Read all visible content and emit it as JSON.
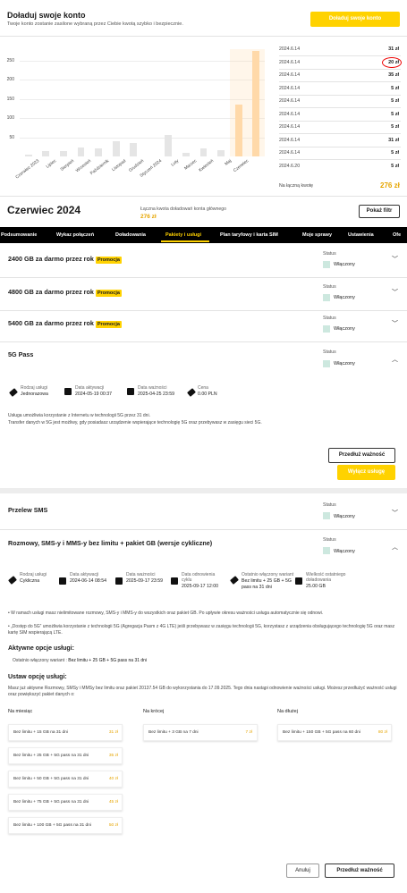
{
  "top": {
    "title": "Doładuj swoje konto",
    "subtitle": "Twoje konto zostanie zasilone wybraną przez Ciebie kwotą szybko i bezpiecznie.",
    "button": "Doładuj swoje konto"
  },
  "chart_data": {
    "type": "bar",
    "categories": [
      "Czerwiec 2023",
      "Lipiec",
      "Sierpień",
      "Wrzesień",
      "Październik",
      "Listopad",
      "Grudzień",
      "Styczeń 2024",
      "Luty",
      "Marzec",
      "Kwiecień",
      "Maj",
      "Czerwiec"
    ],
    "values": [
      5,
      13,
      15,
      24,
      20,
      40,
      35,
      0,
      55,
      10,
      20,
      17,
      135,
      276
    ],
    "yticks": [
      "250",
      "200",
      "150",
      "100",
      "50"
    ],
    "ylim": [
      0,
      280
    ],
    "highlight": "Czerwiec"
  },
  "history": [
    {
      "date": "2024.6.14",
      "amount": "31 zł"
    },
    {
      "date": "2024.6.14",
      "amount": "20 zł"
    },
    {
      "date": "2024.6.14",
      "amount": "35 zł"
    },
    {
      "date": "2024.6.14",
      "amount": "5 zł"
    },
    {
      "date": "2024.6.14",
      "amount": "5 zł"
    },
    {
      "date": "2024.6.14",
      "amount": "5 zł"
    },
    {
      "date": "2024.6.14",
      "amount": "5 zł"
    },
    {
      "date": "2024.6.14",
      "amount": "31 zł"
    },
    {
      "date": "2024.6.14",
      "amount": "5 zł"
    },
    {
      "date": "2024.6.20",
      "amount": "5 zł"
    }
  ],
  "history_sum": {
    "label": "Na łączną kwotę",
    "value": "276 zł"
  },
  "month": {
    "title": "Czerwiec 2024",
    "sub": "Łączna kwota doładowań konta głównego",
    "value": "276 zł",
    "filter_button": "Pokaż filtr"
  },
  "nav": [
    {
      "label": "Podsumowanie"
    },
    {
      "label": "Wykaz połączeń"
    },
    {
      "label": "Doładowania"
    },
    {
      "label": "Pakiety i usługi"
    },
    {
      "label": "Plan taryfowy i karta SIM"
    },
    {
      "label": "Moje sprawy"
    },
    {
      "label": "Ustawienia"
    },
    {
      "label": "Ofe"
    }
  ],
  "promo_label": "Promocja",
  "status_label": "Status",
  "status_value": "Włączony",
  "packages": [
    {
      "title": "2400 GB za darmo przez rok"
    },
    {
      "title": "4800 GB za darmo przez rok"
    },
    {
      "title": "5400 GB za darmo przez rok"
    }
  ],
  "pass5g": {
    "title": "5G Pass",
    "details": [
      {
        "label": "Rodzaj usługi",
        "value": "Jednorazowa"
      },
      {
        "label": "Data aktywacji",
        "value": "2024-05-19 00:37"
      },
      {
        "label": "Data ważności",
        "value": "2025-04-25 23:59"
      },
      {
        "label": "Cena",
        "value": "0.00 PLN"
      }
    ],
    "desc1": "Usługa umożliwia korzystanie z Internetu w technologii 5G przez 31 dni.",
    "desc2": "Transfer danych w 5G jest możliwy, gdy posiadasz urządzenie wspierające technologię 5G oraz przebywasz w zasięgu sieci 5G.",
    "extend": "Przedłuż ważność",
    "disable": "Wyłącz usługę"
  },
  "sms": {
    "title": "Przelew SMS"
  },
  "unlimited": {
    "title": "Rozmowy, SMS-y i MMS-y bez limitu + pakiet GB (wersje cykliczne)",
    "details": [
      {
        "label": "Rodzaj usługi",
        "value": "Cykliczna"
      },
      {
        "label": "Data aktywacji",
        "value": "2024-06-14 08:54"
      },
      {
        "label": "Data ważności",
        "value": "2025-09-17 23:59"
      },
      {
        "label": "Data odnowienia cyklu",
        "value": "2025-09-17 12:00"
      },
      {
        "label": "Ostatnio włączony wariant",
        "value": "Bez limitu + 25 GB + 5G pass na 31 dni"
      },
      {
        "label": "Wielkość ostatniego doładowania",
        "value": "25.00 GB"
      }
    ],
    "bullet1": "W ramach usługi masz nielimitowane rozmowy, SMS-y i MMS-y do wszystkich oraz pakiet GB. Po upływie okresu ważności usługa automatycznie się odnowi.",
    "bullet2": "„Dostęp do 5G” umożliwia korzystanie z technologii 5G (Agregacja Pasm z 4G LTE) jeśli przebywasz w zasięgu technologii 5G, korzystasz z urządzenia obsługującego technologię 5G oraz masz kartę SIM wspierającą LTE.",
    "active_head": "Aktywne opcje usługi:",
    "active_label": "Ostatnio włączony wariant :",
    "active_value": "Bez limitu + 25 GB + 5G pass na 31 dni",
    "set_head": "Ustaw opcję usługi:",
    "set_desc": "Masz już aktywne Rozmowy, SMSy i MMSy bez limitu oraz pakiet 20137.54 GB do wykorzystania do 17.09.2025. Tego dnia nastąpi odnowienie ważności usługi. Możesz przedłużyć ważność usługi oraz powiększyć pakiet danych o:",
    "col_month": "Na miesiąc",
    "col_short": "Na krócej",
    "col_long": "Na dłużej",
    "options_month": [
      {
        "label": "Bez limitu + 15 GB na 31 dni",
        "price": "31 zł"
      },
      {
        "label": "Bez limitu + 25 GB + 5G pass na 31 dni",
        "price": "35 zł"
      },
      {
        "label": "Bez limitu + 50 GB + 5G pass na 31 dni",
        "price": "40 zł"
      },
      {
        "label": "Bez limitu + 75 GB + 5G pass na 31 dni",
        "price": "45 zł"
      },
      {
        "label": "Bez limitu + 100 GB + 5G pass na 31 dni",
        "price": "50 zł"
      }
    ],
    "options_short": [
      {
        "label": "Bez limitu + 3 GB na 7 dni",
        "price": "7 zł"
      }
    ],
    "options_long": [
      {
        "label": "Bez limitu + 150 GB + 5G pass na 60 dni",
        "price": "80 zł"
      }
    ],
    "cancel": "Anuluj",
    "extend": "Przedłuż ważność"
  }
}
